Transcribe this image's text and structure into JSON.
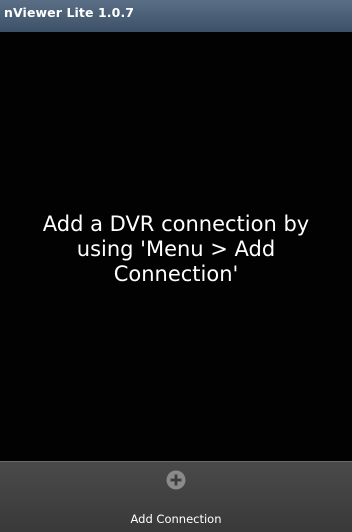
{
  "app": {
    "title": "nViewer Lite 1.0.7"
  },
  "main": {
    "message": "Add a DVR connection by using 'Menu > Add Connection'"
  },
  "menu": {
    "items": [
      {
        "label": "Add Connection",
        "icon": "add-circle-icon"
      }
    ]
  },
  "colors": {
    "title_bar": "#4a5e76",
    "background": "#020202",
    "menu_bar": "#424242",
    "icon_fill": "#8a8a8a"
  }
}
